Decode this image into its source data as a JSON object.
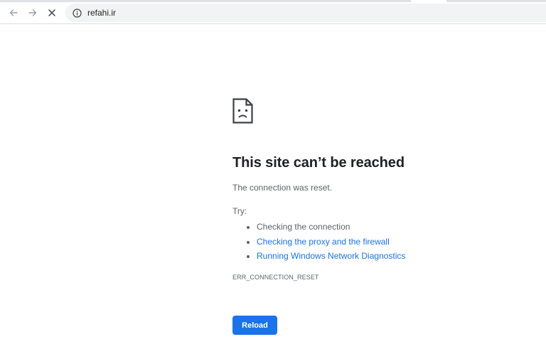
{
  "browser": {
    "url": "refahi.ir",
    "icons": {
      "back": "back-arrow-icon",
      "forward": "forward-arrow-icon",
      "stop": "close-icon",
      "site_info": "info-icon"
    }
  },
  "error_page": {
    "icon": "sad-document-icon",
    "title": "This site can’t be reached",
    "subtitle": "The connection was reset.",
    "try_label": "Try:",
    "suggestions": [
      {
        "label": "Checking the connection",
        "is_link": false
      },
      {
        "label": "Checking the proxy and the firewall",
        "is_link": true
      },
      {
        "label": "Running Windows Network Diagnostics",
        "is_link": true
      }
    ],
    "error_code": "ERR_CONNECTION_RESET",
    "reload_label": "Reload"
  },
  "colors": {
    "accent": "#1a73e8",
    "title_text": "#202124",
    "body_text": "#5f6368",
    "omnibox_bg": "#f1f3f4"
  }
}
